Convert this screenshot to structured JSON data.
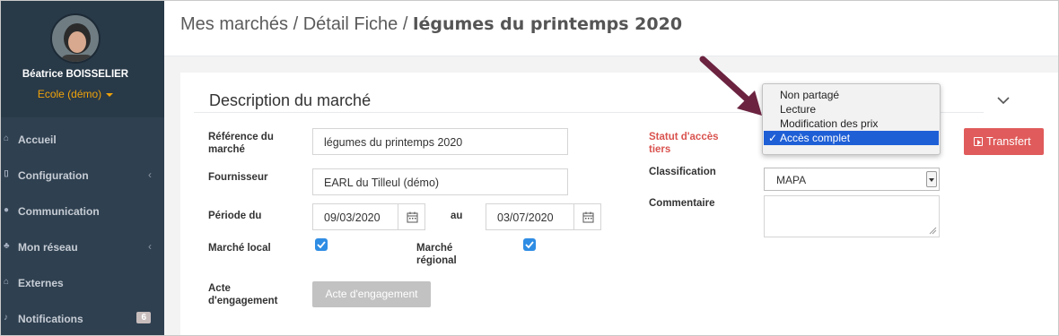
{
  "breadcrumb": {
    "part1": "Mes marchés",
    "sep1": " / ",
    "part2": "Détail Fiche",
    "sep2": " / ",
    "current": "légumes du printemps 2020"
  },
  "user": {
    "name": "Béatrice BOISSELIER",
    "role": "Ecole (démo)"
  },
  "sidebar": {
    "items": [
      {
        "label": "Accueil",
        "icon": "home-icon",
        "has_chevron": false
      },
      {
        "label": "Configuration",
        "icon": "bank-icon",
        "has_chevron": true,
        "chevron": "‹"
      },
      {
        "label": "Communication",
        "icon": "chat-icon",
        "has_chevron": false
      },
      {
        "label": "Mon réseau",
        "icon": "network-icon",
        "has_chevron": true,
        "chevron": "‹"
      },
      {
        "label": "Externes",
        "icon": "home-icon",
        "has_chevron": false
      },
      {
        "label": "Notifications",
        "icon": "bell-icon",
        "badge": "6"
      }
    ]
  },
  "panel": {
    "title": "Description du marché",
    "reference_label": "Référence du marché",
    "reference_value": "légumes du printemps 2020",
    "fournisseur_label": "Fournisseur",
    "fournisseur_value": "EARL du Tilleul (démo)",
    "periode_label": "Période du",
    "date_from": "09/03/2020",
    "au_label": "au",
    "date_to": "03/07/2020",
    "marche_local_label": "Marché local",
    "marche_local_checked": true,
    "marche_regional_label": "Marché régional",
    "marche_regional_checked": true,
    "acte_label": "Acte d'engagement",
    "acte_button": "Acte d'engagement",
    "statut_label": "Statut d'accès tiers",
    "classification_label": "Classification",
    "classification_value": "MAPA",
    "commentaire_label": "Commentaire",
    "transfert_button": "Transfert"
  },
  "dropdown": {
    "options": [
      "Non partagé",
      "Lecture",
      "Modification des prix",
      "Accès complet"
    ],
    "selected_index": 3,
    "check_mark": "✓"
  },
  "colors": {
    "sidebar": "#2f4050",
    "role": "#f0a30a",
    "accent_blue": "#2f8de4",
    "transfer_red": "#e05b5b",
    "label_red": "#d9534f",
    "dropdown_selected": "#1f5fd6",
    "arrow": "#6b2340"
  }
}
